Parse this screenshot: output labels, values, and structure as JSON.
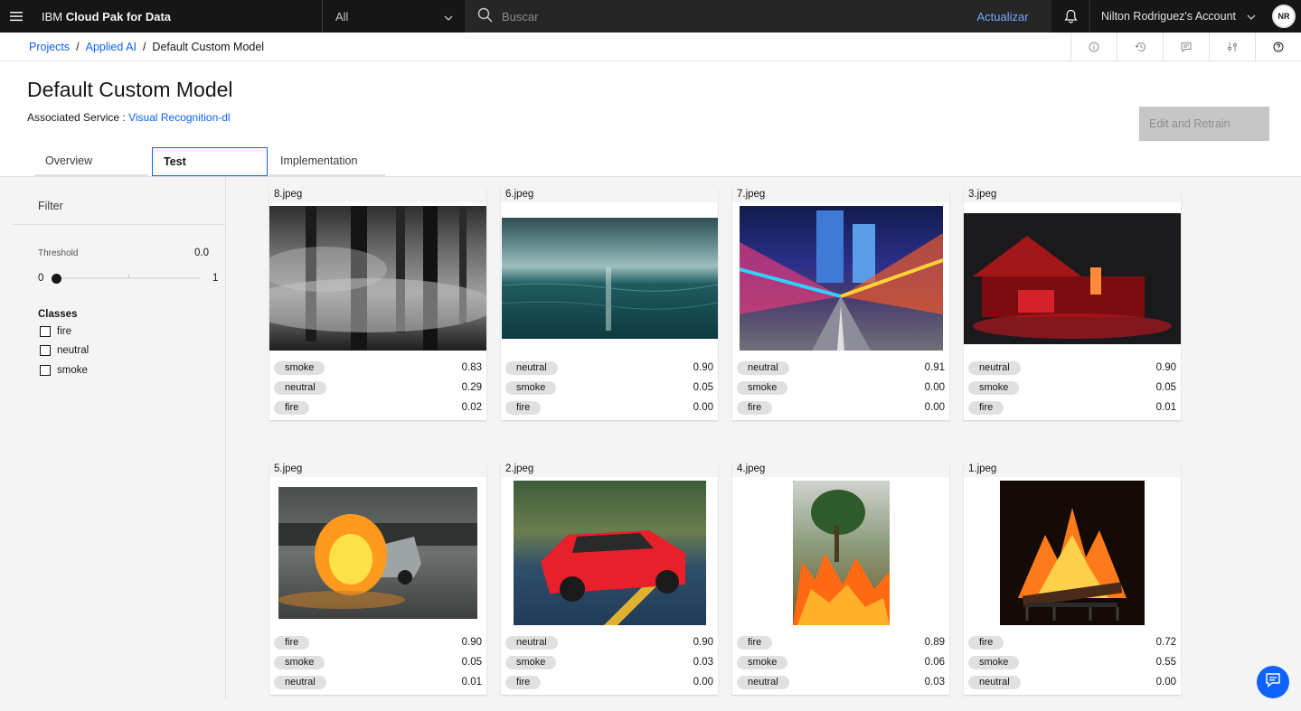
{
  "topbar": {
    "brand_prefix": "IBM ",
    "brand_name": "Cloud Pak for Data",
    "scope_value": "All",
    "search_placeholder": "Buscar",
    "update_label": "Actualizar",
    "account_name": "Nilton Rodriguez's Account",
    "avatar_initials": "NR"
  },
  "breadcrumb": {
    "items": [
      "Projects",
      "Applied AI",
      "Default Custom Model"
    ],
    "separator": "/"
  },
  "header": {
    "title": "Default Custom Model",
    "assoc_label": "Associated Service : ",
    "assoc_link": "Visual Recognition-dl",
    "retrain_label": "Edit and Retrain"
  },
  "tabs": [
    {
      "label": "Overview",
      "active": false
    },
    {
      "label": "Test",
      "active": true
    },
    {
      "label": "Implementation",
      "active": false
    }
  ],
  "sidebar": {
    "filter_label": "Filter",
    "threshold_label": "Threshold",
    "threshold_value": "0.0",
    "slider_min": "0",
    "slider_max": "1",
    "classes_label": "Classes",
    "classes": [
      "fire",
      "neutral",
      "smoke"
    ]
  },
  "cards": [
    {
      "file": "8.jpeg",
      "scene": "smoky-forest",
      "rows": [
        [
          "smoke",
          "0.83"
        ],
        [
          "neutral",
          "0.29"
        ],
        [
          "fire",
          "0.02"
        ]
      ]
    },
    {
      "file": "6.jpeg",
      "scene": "ocean",
      "rows": [
        [
          "neutral",
          "0.90"
        ],
        [
          "smoke",
          "0.05"
        ],
        [
          "fire",
          "0.00"
        ]
      ]
    },
    {
      "file": "7.jpeg",
      "scene": "city-lights",
      "rows": [
        [
          "neutral",
          "0.91"
        ],
        [
          "smoke",
          "0.00"
        ],
        [
          "fire",
          "0.00"
        ]
      ]
    },
    {
      "file": "3.jpeg",
      "scene": "red-house",
      "rows": [
        [
          "neutral",
          "0.90"
        ],
        [
          "smoke",
          "0.05"
        ],
        [
          "fire",
          "0.01"
        ]
      ]
    },
    {
      "file": "5.jpeg",
      "scene": "burning-car",
      "rows": [
        [
          "fire",
          "0.90"
        ],
        [
          "smoke",
          "0.05"
        ],
        [
          "neutral",
          "0.01"
        ]
      ]
    },
    {
      "file": "2.jpeg",
      "scene": "red-car",
      "rows": [
        [
          "neutral",
          "0.90"
        ],
        [
          "smoke",
          "0.03"
        ],
        [
          "fire",
          "0.00"
        ]
      ]
    },
    {
      "file": "4.jpeg",
      "scene": "brush-fire",
      "rows": [
        [
          "fire",
          "0.89"
        ],
        [
          "smoke",
          "0.06"
        ],
        [
          "neutral",
          "0.03"
        ]
      ]
    },
    {
      "file": "1.jpeg",
      "scene": "fireplace",
      "rows": [
        [
          "fire",
          "0.72"
        ],
        [
          "smoke",
          "0.55"
        ],
        [
          "neutral",
          "0.00"
        ]
      ]
    }
  ],
  "colors": {
    "accent": "#0f62fe",
    "topbar_bg": "#161616",
    "pill_bg": "#e0e0e0"
  }
}
